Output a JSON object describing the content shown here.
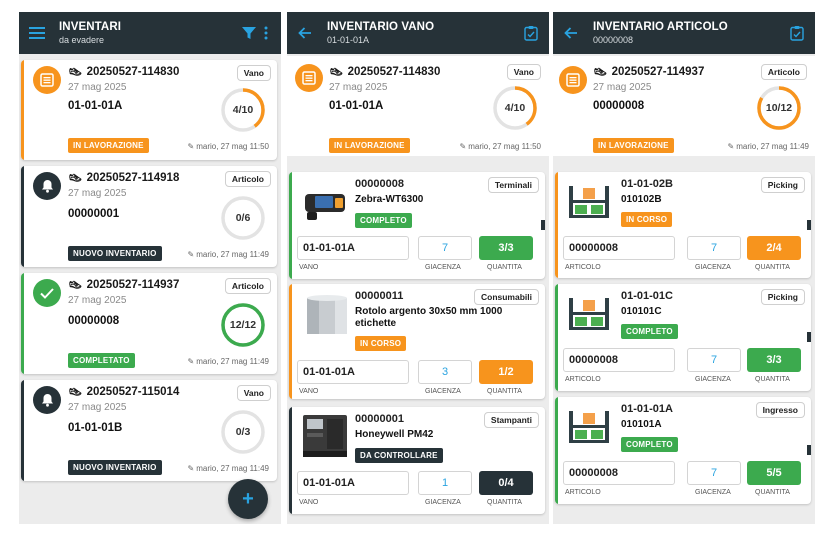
{
  "colors": {
    "appbar": "#263238",
    "accent": "#29a3e0",
    "orange": "#f7941d",
    "green": "#3caa4e",
    "dark": "#263238",
    "grey_ring": "#e3e3e3"
  },
  "screen1": {
    "title": "INVENTARI",
    "subtitle": "da evadere",
    "cards": [
      {
        "code": "20250527-114830",
        "date": "27 mag 2025",
        "ref": "01-01-01A",
        "type": "Vano",
        "progress": "4/10",
        "progress_value": 0.4,
        "status": "IN LAVORAZIONE",
        "meta": "mario, 27 mag 11:50",
        "icon": "document-list-icon"
      },
      {
        "code": "20250527-114918",
        "date": "27 mag 2025",
        "ref": "00000001",
        "type": "Articolo",
        "progress": "0/6",
        "progress_value": 0,
        "status": "NUOVO INVENTARIO",
        "meta": "mario, 27 mag 11:49",
        "icon": "bell-icon"
      },
      {
        "code": "20250527-114937",
        "date": "27 mag 2025",
        "ref": "00000008",
        "type": "Articolo",
        "progress": "12/12",
        "progress_value": 1,
        "status": "COMPLETATO",
        "meta": "mario, 27 mag 11:49",
        "icon": "check-icon"
      },
      {
        "code": "20250527-115014",
        "date": "27 mag 2025",
        "ref": "01-01-01B",
        "type": "Vano",
        "progress": "0/3",
        "progress_value": 0,
        "status": "NUOVO INVENTARIO",
        "meta": "mario, 27 mag 11:49",
        "icon": "bell-icon"
      }
    ],
    "fab_label": "+"
  },
  "screen2": {
    "title": "INVENTARIO VANO",
    "subtitle": "01-01-01A",
    "header": {
      "code": "20250527-114830",
      "date": "27 mag 2025",
      "ref": "01-01-01A",
      "type": "Vano",
      "progress": "4/10",
      "progress_value": 0.4,
      "status": "IN LAVORAZIONE",
      "meta": "mario, 27 mag 11:50"
    },
    "items": [
      {
        "code": "00000008",
        "name": "Zebra-WT6300",
        "category": "Terminali",
        "status": "COMPLETO",
        "location": "01-01-01A",
        "stock": "7",
        "qty": "3/3",
        "thumb": "handheld-terminal-image"
      },
      {
        "code": "00000011",
        "name": "Rotolo argento 30x50 mm 1000 etichette",
        "category": "Consumabili",
        "status": "IN CORSO",
        "location": "01-01-01A",
        "stock": "3",
        "qty": "1/2",
        "thumb": "label-roll-image"
      },
      {
        "code": "00000001",
        "name": "Honeywell PM42",
        "category": "Stampanti",
        "status": "DA CONTROLLARE",
        "location": "01-01-01A",
        "stock": "1",
        "qty": "0/4",
        "thumb": "label-printer-image"
      }
    ],
    "cap_location": "VANO",
    "cap_stock": "GIACENZA",
    "cap_qty": "QUANTITA"
  },
  "screen3": {
    "title": "INVENTARIO ARTICOLO",
    "subtitle": "00000008",
    "header": {
      "code": "20250527-114937",
      "date": "27 mag 2025",
      "ref": "00000008",
      "type": "Articolo",
      "progress": "10/12",
      "progress_value": 0.833,
      "status": "IN LAVORAZIONE",
      "meta": "mario, 27 mag 11:49"
    },
    "items": [
      {
        "location": "01-01-02B",
        "subloc": "010102B",
        "category": "Picking",
        "status": "IN CORSO",
        "article": "00000008",
        "stock": "7",
        "qty": "2/4"
      },
      {
        "location": "01-01-01C",
        "subloc": "010101C",
        "category": "Picking",
        "status": "COMPLETO",
        "article": "00000008",
        "stock": "7",
        "qty": "3/3"
      },
      {
        "location": "01-01-01A",
        "subloc": "010101A",
        "category": "Ingresso",
        "status": "COMPLETO",
        "article": "00000008",
        "stock": "7",
        "qty": "5/5"
      }
    ],
    "cap_article": "ARTICOLO",
    "cap_stock": "GIACENZA",
    "cap_qty": "QUANTITA"
  }
}
